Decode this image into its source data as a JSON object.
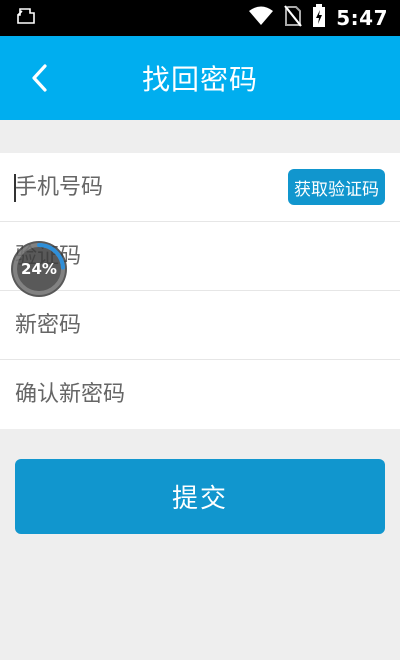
{
  "status_bar": {
    "time": "5:47",
    "icons": [
      "notification-icon",
      "wifi-icon",
      "no-sim-icon",
      "battery-charging-icon"
    ]
  },
  "header": {
    "title": "找回密码",
    "back_icon": "chevron-left-icon"
  },
  "form": {
    "phone_placeholder": "手机号码",
    "get_code_label": "获取验证码",
    "code_placeholder": "验证码",
    "new_password_placeholder": "新密码",
    "confirm_password_placeholder": "确认新密码"
  },
  "progress": {
    "label": "24%",
    "value": 0.24
  },
  "submit_label": "提交",
  "colors": {
    "app_bar": "#00aeef",
    "button": "#1196ce",
    "background": "#eeeeee"
  }
}
